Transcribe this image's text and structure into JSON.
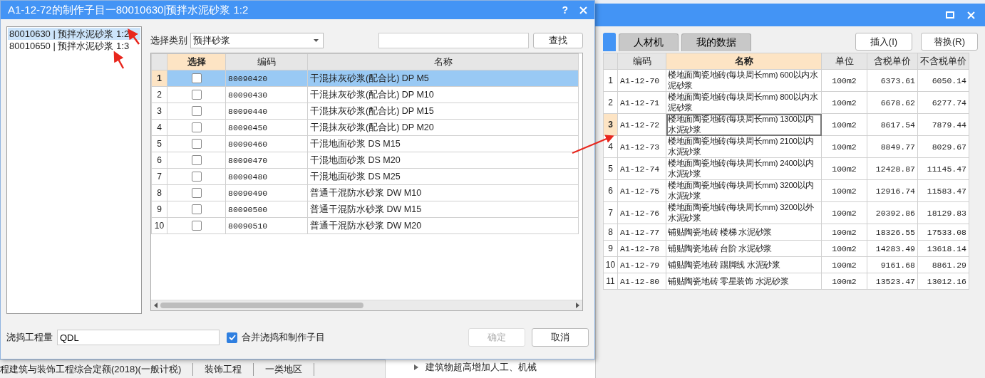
{
  "background_window": {
    "tabs": [
      {
        "selected": true
      },
      {
        "label": "人材机",
        "selected": false
      },
      {
        "label": "我的数据",
        "selected": false
      }
    ],
    "buttons": [
      "插入(I)",
      "替换(R)"
    ],
    "table": {
      "columns": [
        {
          "highlighted": false
        },
        {
          "label": "编码",
          "highlighted": false
        },
        {
          "label": "名称",
          "highlighted": true
        },
        {
          "label": "单位",
          "highlighted": false
        },
        {
          "label": "含税单价",
          "highlighted": false
        },
        {
          "label": "不含税单价",
          "highlighted": false
        }
      ],
      "rows": [
        {
          "num": "1",
          "code": "A1-12-70",
          "name": "楼地面陶瓷地砖(每块周长mm) 600以内水泥砂浆",
          "unit": "100m2",
          "price_tax": "6373.61",
          "price_notax": "6050.14",
          "selected": false
        },
        {
          "num": "2",
          "code": "A1-12-71",
          "name": "楼地面陶瓷地砖(每块周长mm) 800以内水泥砂浆",
          "unit": "100m2",
          "price_tax": "6678.62",
          "price_notax": "6277.74",
          "selected": false
        },
        {
          "num": "3",
          "code": "A1-12-72",
          "name": "楼地面陶瓷地砖(每块周长mm) 1300以内水泥砂浆",
          "unit": "100m2",
          "price_tax": "8617.54",
          "price_notax": "7879.44",
          "selected": true
        },
        {
          "num": "4",
          "code": "A1-12-73",
          "name": "楼地面陶瓷地砖(每块周长mm) 2100以内水泥砂浆",
          "unit": "100m2",
          "price_tax": "8849.77",
          "price_notax": "8029.67",
          "selected": false
        },
        {
          "num": "5",
          "code": "A1-12-74",
          "name": "楼地面陶瓷地砖(每块周长mm) 2400以内水泥砂浆",
          "unit": "100m2",
          "price_tax": "12428.87",
          "price_notax": "11145.47",
          "selected": false
        },
        {
          "num": "6",
          "code": "A1-12-75",
          "name": "楼地面陶瓷地砖(每块周长mm) 3200以内水泥砂浆",
          "unit": "100m2",
          "price_tax": "12916.74",
          "price_notax": "11583.47",
          "selected": false
        },
        {
          "num": "7",
          "code": "A1-12-76",
          "name": "楼地面陶瓷地砖(每块周长mm) 3200以外水泥砂浆",
          "unit": "100m2",
          "price_tax": "20392.86",
          "price_notax": "18129.83",
          "selected": false
        },
        {
          "num": "8",
          "code": "A1-12-77",
          "name": "铺贴陶瓷地砖 楼梯 水泥砂浆",
          "unit": "100m2",
          "price_tax": "18326.55",
          "price_notax": "17533.08",
          "selected": false
        },
        {
          "num": "9",
          "code": "A1-12-78",
          "name": "铺贴陶瓷地砖 台阶 水泥砂浆",
          "unit": "100m2",
          "price_tax": "14283.49",
          "price_notax": "13618.14",
          "selected": false
        },
        {
          "num": "10",
          "code": "A1-12-79",
          "name": "铺贴陶瓷地砖 踢脚线 水泥砂浆",
          "unit": "100m2",
          "price_tax": "9161.68",
          "price_notax": "8861.29",
          "selected": false
        },
        {
          "num": "11",
          "code": "A1-12-80",
          "name": "铺贴陶瓷地砖 零星装饰 水泥砂浆",
          "unit": "100m2",
          "price_tax": "13523.47",
          "price_notax": "13012.16",
          "selected": false
        }
      ]
    },
    "status_bar": [
      "程建筑与装饰工程综合定额(2018)(一般计税)",
      "装饰工程",
      "一类地区"
    ],
    "tree_item": "建筑物超高增加人工、机械"
  },
  "dialog": {
    "title": "A1-12-72的制作子目一80010630|预拌水泥砂浆 1:2",
    "help": "?",
    "list": [
      {
        "label": "80010630 | 预拌水泥砂浆 1:2",
        "selected": true
      },
      {
        "label": "80010650 | 预拌水泥砂浆 1:3",
        "selected": false
      }
    ],
    "category": {
      "label": "选择类别",
      "value": "预拌砂浆"
    },
    "search": {
      "button": "查找"
    },
    "grid": {
      "columns": [
        {
          "highlighted": false
        },
        {
          "label": "选择",
          "highlighted": true
        },
        {
          "label": "编码",
          "highlighted": false
        },
        {
          "label": "名称",
          "highlighted": false
        }
      ],
      "rows": [
        {
          "num": "1",
          "code": "80090420",
          "name": "干混抹灰砂浆(配合比) DP M5",
          "checked": false,
          "selected": true
        },
        {
          "num": "2",
          "code": "80090430",
          "name": "干混抹灰砂浆(配合比) DP M10",
          "checked": false,
          "selected": false
        },
        {
          "num": "3",
          "code": "80090440",
          "name": "干混抹灰砂浆(配合比) DP M15",
          "checked": false,
          "selected": false
        },
        {
          "num": "4",
          "code": "80090450",
          "name": "干混抹灰砂浆(配合比) DP M20",
          "checked": false,
          "selected": false
        },
        {
          "num": "5",
          "code": "80090460",
          "name": "干混地面砂浆 DS M15",
          "checked": false,
          "selected": false
        },
        {
          "num": "6",
          "code": "80090470",
          "name": "干混地面砂浆 DS M20",
          "checked": false,
          "selected": false
        },
        {
          "num": "7",
          "code": "80090480",
          "name": "干混地面砂浆 DS M25",
          "checked": false,
          "selected": false
        },
        {
          "num": "8",
          "code": "80090490",
          "name": "普通干混防水砂浆 DW M10",
          "checked": false,
          "selected": false
        },
        {
          "num": "9",
          "code": "80090500",
          "name": "普通干混防水砂浆 DW M15",
          "checked": false,
          "selected": false
        },
        {
          "num": "10",
          "code": "80090510",
          "name": "普通干混防水砂浆 DW M20",
          "checked": false,
          "selected": false
        }
      ]
    },
    "quantity": {
      "label": "浇捣工程量",
      "value": "QDL"
    },
    "merge": {
      "label": "合并浇捣和制作子目",
      "checked": true
    },
    "buttons": [
      {
        "label": "确定",
        "disabled": true
      },
      {
        "label": "取消",
        "disabled": false
      }
    ]
  }
}
